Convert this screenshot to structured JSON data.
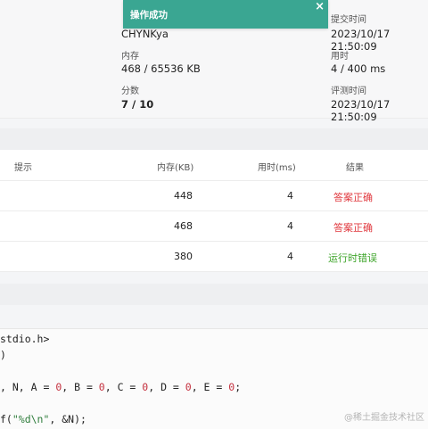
{
  "toast": {
    "text": "操作成功",
    "close": "×"
  },
  "info": {
    "user_value": "CHYNKya",
    "submit_time_label": "提交时间",
    "submit_time_value": "2023/10/17 21:50:09",
    "memory_label": "内存",
    "memory_value": "468 / 65536 KB",
    "time_label": "用时",
    "time_value": "4 / 400 ms",
    "score_label": "分数",
    "score_value": "7 / 10",
    "judge_time_label": "评测时间",
    "judge_time_value": "2023/10/17 21:50:09"
  },
  "table": {
    "headers": {
      "hint": "提示",
      "memory": "内存(KB)",
      "time": "用时(ms)",
      "result": "结果"
    },
    "rows": [
      {
        "memory": "448",
        "time": "4",
        "result": "答案正确",
        "result_color": "#e0383e"
      },
      {
        "memory": "468",
        "time": "4",
        "result": "答案正确",
        "result_color": "#e0383e"
      },
      {
        "memory": "380",
        "time": "4",
        "result": "运行时错误",
        "result_color": "#3fa52b"
      }
    ]
  },
  "code": {
    "line1": "stdio.h>",
    "line2": ")",
    "line3_a": ", N, A = ",
    "line3_n1": "0",
    "line3_b": ", B = ",
    "line3_n2": "0",
    "line3_c": ", C = ",
    "line3_n3": "0",
    "line3_d": ", D = ",
    "line3_n4": "0",
    "line3_e": ", E = ",
    "line3_n5": "0",
    "line3_end": ";",
    "line4_a": "f(",
    "line4_str": "\"%d\\n\"",
    "line4_b": ", &N);"
  },
  "watermark": "@稀土掘金技术社区"
}
